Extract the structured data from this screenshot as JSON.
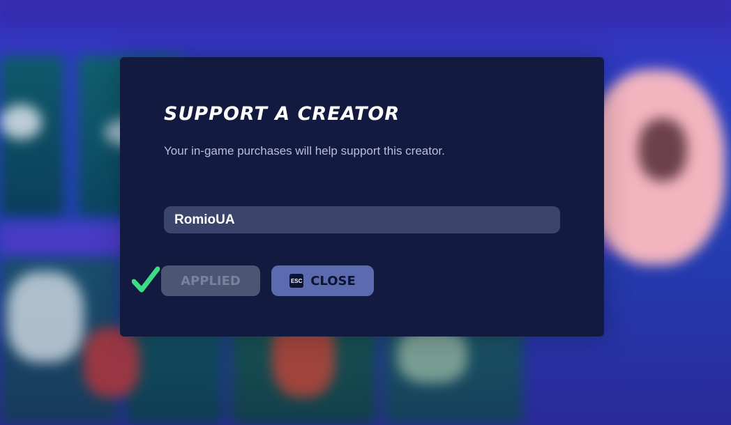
{
  "dialog": {
    "title": "SUPPORT A CREATOR",
    "subtitle": "Your in-game purchases will help support this creator.",
    "creator_code": {
      "value": "RomioUA",
      "placeholder": ""
    },
    "status_icon": "check-icon",
    "applied_button": {
      "label": "APPLIED",
      "disabled": true
    },
    "close_button": {
      "key_hint": "ESC",
      "label": "CLOSE"
    }
  },
  "colors": {
    "dialog_bg": "#121a3f",
    "input_bg": "#3b456b",
    "check": "#3ddc84",
    "applied_bg": "#4d5575",
    "close_bg": "#5c6ab0"
  }
}
